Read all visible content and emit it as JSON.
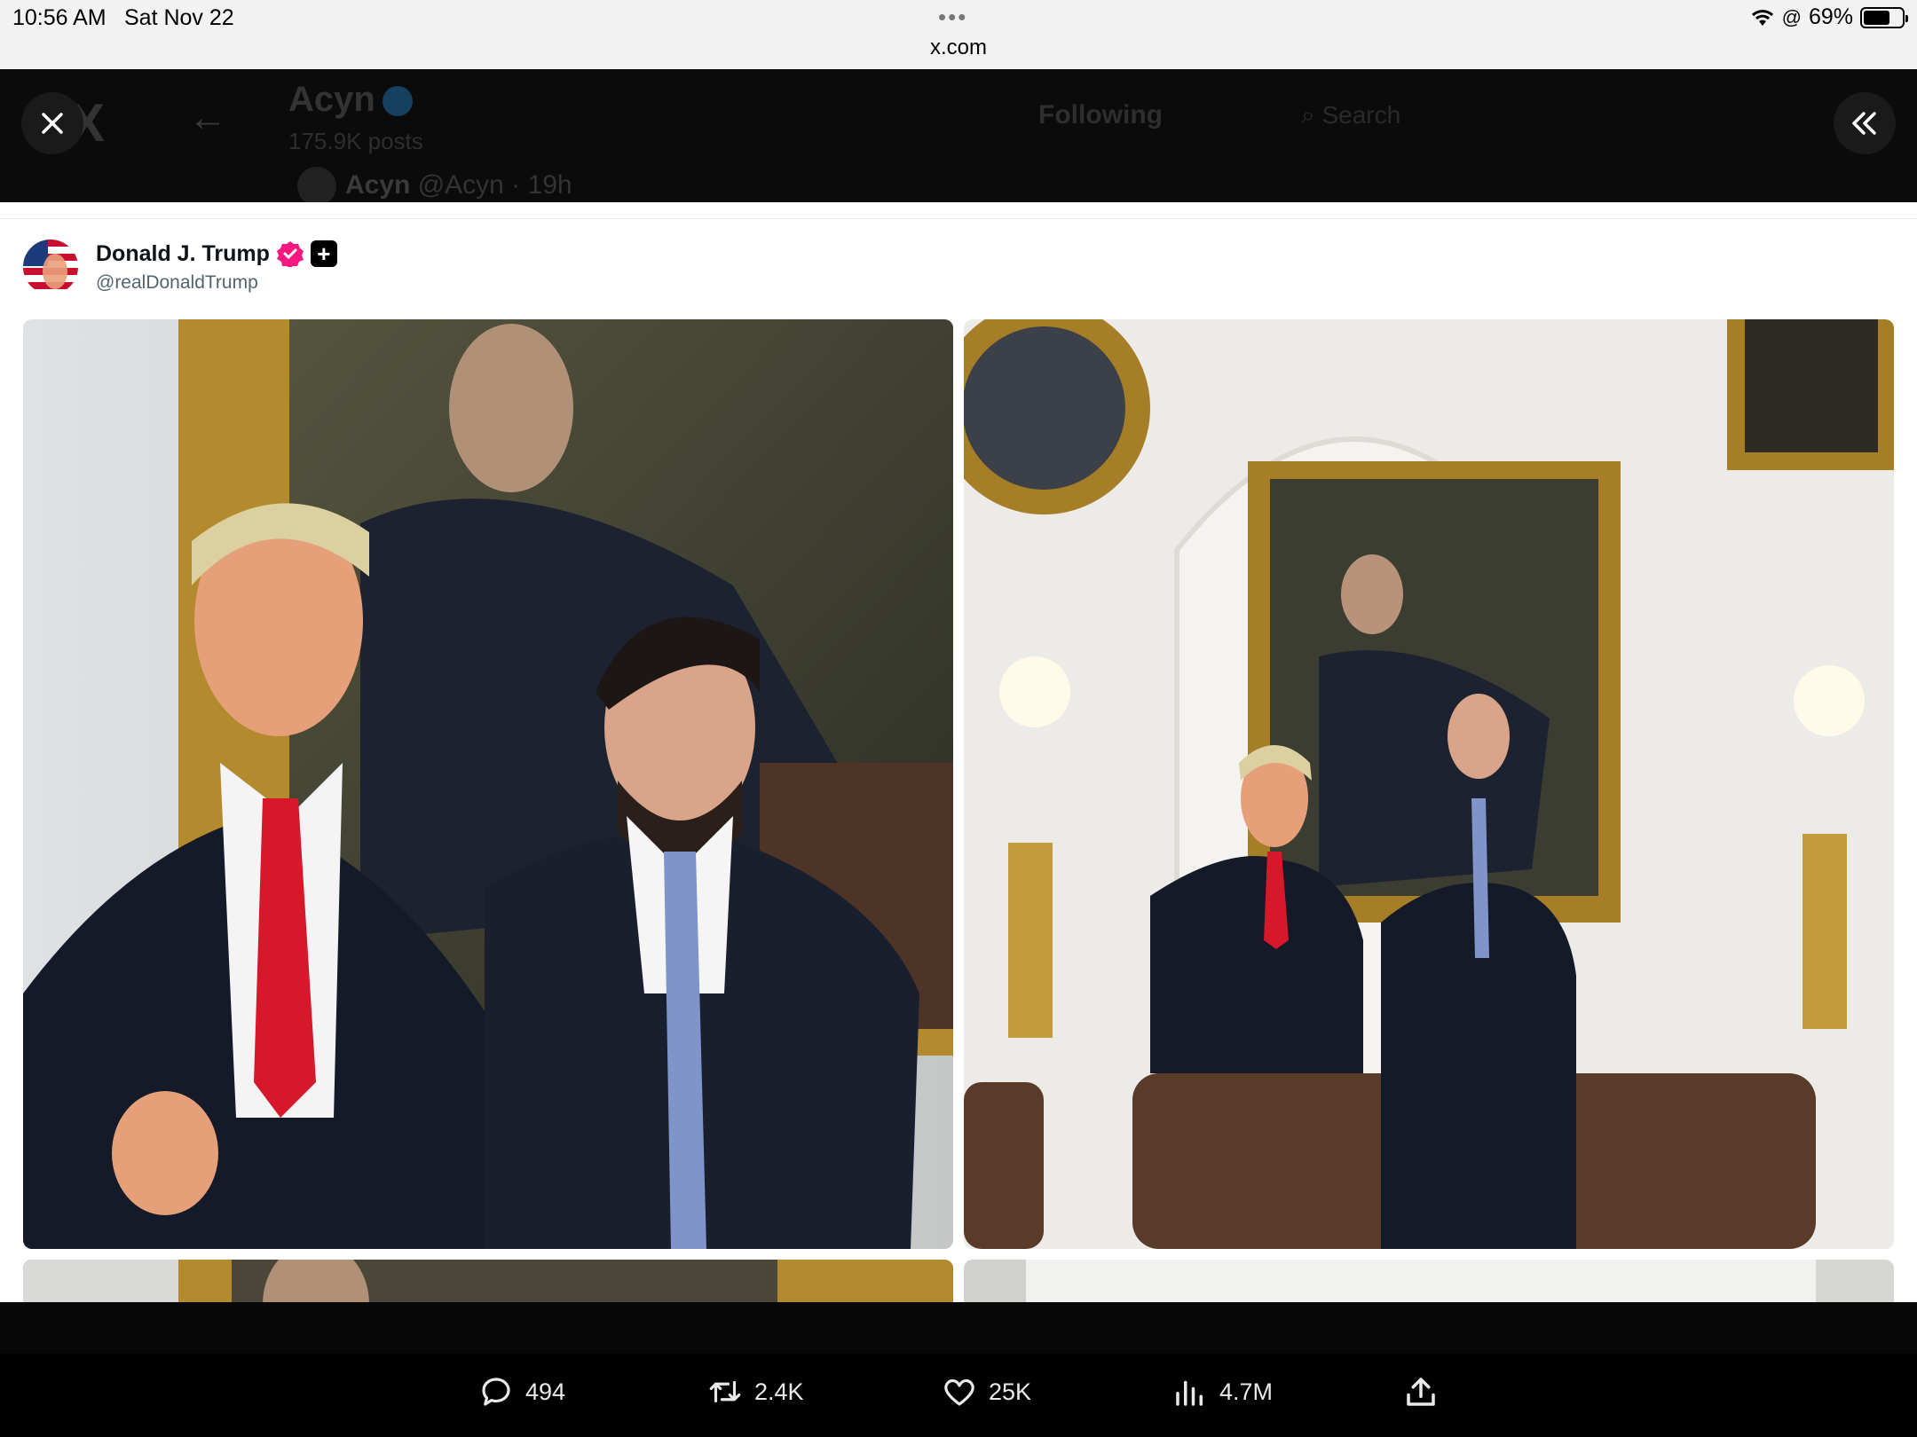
{
  "status_bar": {
    "time": "10:56 AM",
    "date": "Sat Nov 22",
    "url": "x.com",
    "battery": "69%",
    "battery_level": 0.69
  },
  "background_header": {
    "back_icon": "arrow-left-icon",
    "title": "Acyn",
    "posts": "175.9K posts",
    "tab": "Following",
    "search_placeholder": "Search",
    "user_name": "Acyn",
    "user_handle": "@Acyn · 19h"
  },
  "overlay": {
    "close_icon": "close-icon",
    "collapse_icon": "double-chevron-left-icon"
  },
  "post": {
    "author_name": "Donald J. Trump",
    "author_handle": "@realDonaldTrump",
    "verified_color": "#f91880",
    "photos": [
      "photo-1",
      "photo-2",
      "photo-3",
      "photo-4"
    ]
  },
  "actions": {
    "replies": "494",
    "reposts": "2.4K",
    "likes": "25K",
    "views": "4.7M"
  },
  "colors": {
    "accent": "#1d9bf0",
    "text": "#0f1419",
    "muted": "#536471"
  }
}
